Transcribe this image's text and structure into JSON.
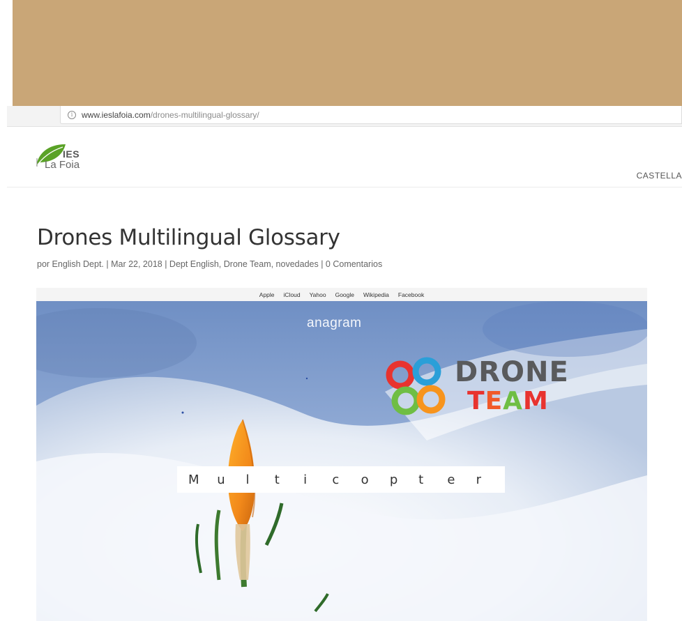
{
  "browser": {
    "url_host": "www.ieslafoia.com",
    "url_path": "/drones-multilingual-glossary/"
  },
  "header": {
    "logo_top": "IES",
    "logo_bottom": "La Foia",
    "nav_item": "CASTELLA"
  },
  "post": {
    "title": "Drones Multilingual Glossary",
    "meta": "por English Dept. | Mar 22, 2018 | Dept English, Drone Team, novedades | 0 Comentarios"
  },
  "featured_image": {
    "bookmarks": [
      "Apple",
      "iCloud",
      "Yahoo",
      "Google",
      "Wikipedia",
      "Facebook"
    ],
    "anagram_title": "anagram",
    "word_letters": [
      "M",
      "u",
      "l",
      "t",
      "i",
      "c",
      "o",
      "p",
      "t",
      "e",
      "r"
    ],
    "logo_word_1": "DRONE",
    "logo_word_2": "TEAM"
  },
  "colors": {
    "banner": "#c9a677",
    "drone_grey": "#595a5c",
    "team_orange": "#f15a29",
    "team_green": "#6fbe44",
    "team_blue": "#2a9fd8",
    "team_red": "#e8332f"
  }
}
